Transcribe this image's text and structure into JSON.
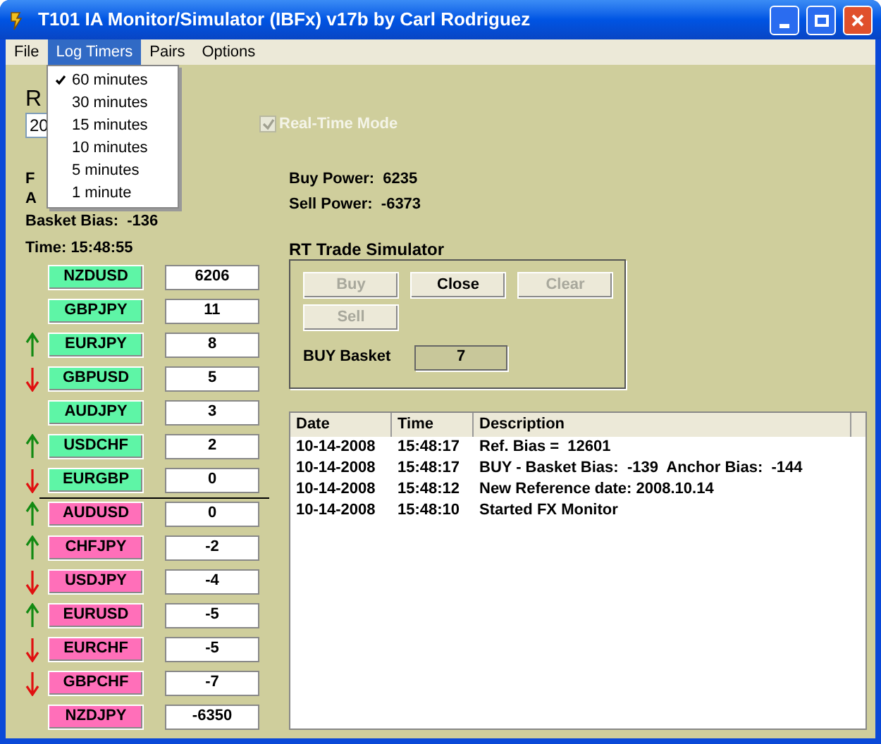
{
  "window": {
    "title": "T101 IA Monitor/Simulator (IBFx) v17b by Carl Rodriguez"
  },
  "menu": [
    {
      "label": "File",
      "selected": false
    },
    {
      "label": "Log Timers",
      "selected": true
    },
    {
      "label": "Pairs",
      "selected": false
    },
    {
      "label": "Options",
      "selected": false
    }
  ],
  "dropdown": [
    {
      "label": "60 minutes",
      "checked": true
    },
    {
      "label": "30 minutes",
      "checked": false
    },
    {
      "label": "15 minutes",
      "checked": false
    },
    {
      "label": "10 minutes",
      "checked": false
    },
    {
      "label": "5 minutes",
      "checked": false
    },
    {
      "label": "1 minute",
      "checked": false
    }
  ],
  "left_labels": {
    "reference_label": "R",
    "reference_value": "20",
    "label_1": "F",
    "label_2": "A",
    "basket_bias": "Basket Bias:  -136",
    "time": "Time: 15:48:55"
  },
  "real_time_mode": {
    "label": "Real-Time Mode",
    "checked": true,
    "disabled": true
  },
  "buy_power": "Buy Power:  6235",
  "sell_power": "Sell Power:  -6373",
  "pairs": [
    {
      "name": "NZDUSD",
      "value": "6206",
      "color": "#5ef5a6",
      "kind": "plain"
    },
    {
      "name": "GBPJPY",
      "value": "11",
      "color": "#5ef5a6",
      "kind": "plain"
    },
    {
      "name": "EURJPY",
      "value": "8",
      "color": "#5ef5a6",
      "kind": "up"
    },
    {
      "name": "GBPUSD",
      "value": "5",
      "color": "#5ef5a6",
      "kind": "down"
    },
    {
      "name": "AUDJPY",
      "value": "3",
      "color": "#5ef5a6",
      "kind": "plain"
    },
    {
      "name": "USDCHF",
      "value": "2",
      "color": "#5ef5a6",
      "kind": "up"
    },
    {
      "name": "EURGBP",
      "value": "0",
      "color": "#5ef5a6",
      "kind": "down"
    },
    {
      "name": "AUDUSD",
      "value": "0",
      "color": "#ff6fb9",
      "kind": "up"
    },
    {
      "name": "CHFJPY",
      "value": "-2",
      "color": "#ff6fb9",
      "kind": "up"
    },
    {
      "name": "USDJPY",
      "value": "-4",
      "color": "#ff6fb9",
      "kind": "down"
    },
    {
      "name": "EURUSD",
      "value": "-5",
      "color": "#ff6fb9",
      "kind": "up"
    },
    {
      "name": "EURCHF",
      "value": "-5",
      "color": "#ff6fb9",
      "kind": "down"
    },
    {
      "name": "GBPCHF",
      "value": "-7",
      "color": "#ff6fb9",
      "kind": "down"
    },
    {
      "name": "NZDJPY",
      "value": "-6350",
      "color": "#ff6fb9",
      "kind": "plain"
    }
  ],
  "simulator": {
    "title": "RT Trade Simulator",
    "buttons": [
      {
        "label": "Buy",
        "disabled": true
      },
      {
        "label": "Close",
        "disabled": false
      },
      {
        "label": "Clear",
        "disabled": true
      },
      {
        "label": "Sell",
        "disabled": true
      }
    ],
    "basket_label": "BUY Basket",
    "basket_value": "7"
  },
  "log": {
    "columns": [
      "Date",
      "Time",
      "Description"
    ],
    "rows": [
      [
        "10-14-2008",
        "15:48:17",
        "Ref. Bias =  12601"
      ],
      [
        "10-14-2008",
        "15:48:17",
        "BUY - Basket Bias:  -139  Anchor Bias:  -144"
      ],
      [
        "10-14-2008",
        "15:48:12",
        "New Reference date: 2008.10.14"
      ],
      [
        "10-14-2008",
        "15:48:10",
        "Started FX Monitor"
      ]
    ]
  }
}
